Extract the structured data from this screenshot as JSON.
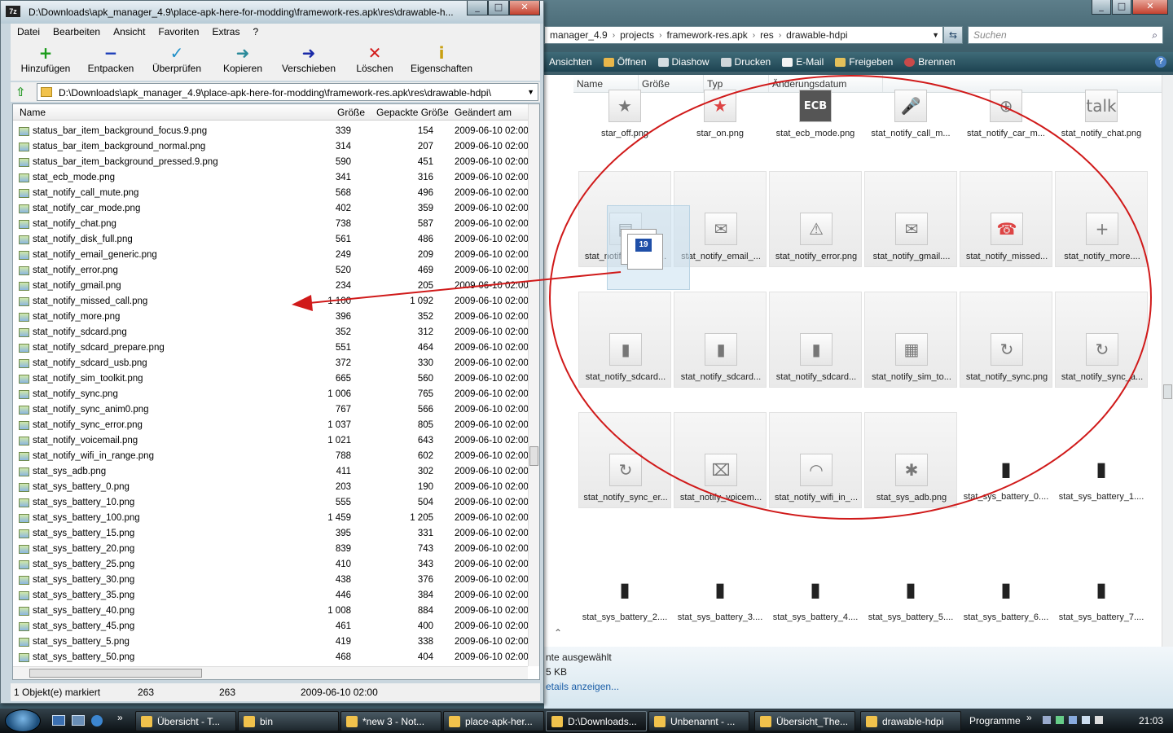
{
  "explorer": {
    "breadcrumb": [
      "manager_4.9",
      "projects",
      "framework-res.apk",
      "res",
      "drawable-hdpi"
    ],
    "search_placeholder": "Suchen",
    "commands": [
      "Ansichten",
      "Öffnen",
      "Diashow",
      "Drucken",
      "E-Mail",
      "Freigeben",
      "Brennen"
    ],
    "columns": [
      "Name",
      "Größe",
      "Typ",
      "Änderungsdatum"
    ],
    "tiles": [
      {
        "label": "star_off.png",
        "icon": "star-outline-icon",
        "glyph": "★"
      },
      {
        "label": "star_on.png",
        "icon": "star-filled-icon",
        "glyph": "★"
      },
      {
        "label": "stat_ecb_mode.png",
        "icon": "ecb-icon",
        "glyph": "ECB"
      },
      {
        "label": "stat_notify_call_m...",
        "icon": "mute-mic-icon",
        "glyph": "🎤"
      },
      {
        "label": "stat_notify_car_m...",
        "icon": "car-wheel-icon",
        "glyph": "⊕"
      },
      {
        "label": "stat_notify_chat.png",
        "icon": "talk-bubble-icon",
        "glyph": "talk"
      },
      {
        "label": "stat_notify_disk_fu...",
        "icon": "disk-icon",
        "glyph": "▤"
      },
      {
        "label": "stat_notify_email_...",
        "icon": "envelope-icon",
        "glyph": "✉"
      },
      {
        "label": "stat_notify_error.png",
        "icon": "warning-icon",
        "glyph": "⚠"
      },
      {
        "label": "stat_notify_gmail....",
        "icon": "gmail-envelope-icon",
        "glyph": "✉"
      },
      {
        "label": "stat_notify_missed...",
        "icon": "missed-call-icon",
        "glyph": "☎"
      },
      {
        "label": "stat_notify_more....",
        "icon": "plus-icon",
        "glyph": "+"
      },
      {
        "label": "stat_notify_sdcard...",
        "icon": "sdcard-icon",
        "glyph": "▮"
      },
      {
        "label": "stat_notify_sdcard...",
        "icon": "sdcard-prepare-icon",
        "glyph": "▮"
      },
      {
        "label": "stat_notify_sdcard...",
        "icon": "sdcard-usb-icon",
        "glyph": "▮"
      },
      {
        "label": "stat_notify_sim_to...",
        "icon": "sim-icon",
        "glyph": "▦"
      },
      {
        "label": "stat_notify_sync.png",
        "icon": "sync-icon",
        "glyph": "↻"
      },
      {
        "label": "stat_notify_sync_a...",
        "icon": "sync-anim-icon",
        "glyph": "↻"
      },
      {
        "label": "stat_notify_sync_er...",
        "icon": "sync-error-icon",
        "glyph": "↻"
      },
      {
        "label": "stat_notify_voicem...",
        "icon": "voicemail-icon",
        "glyph": "⌧"
      },
      {
        "label": "stat_notify_wifi_in_...",
        "icon": "wifi-icon",
        "glyph": "◠"
      },
      {
        "label": "stat_sys_adb.png",
        "icon": "android-icon",
        "glyph": "✱"
      },
      {
        "label": "stat_sys_battery_0....",
        "icon": "battery-icon",
        "glyph": "▮"
      },
      {
        "label": "stat_sys_battery_1....",
        "icon": "battery-icon",
        "glyph": "▮"
      },
      {
        "label": "stat_sys_battery_2....",
        "icon": "battery-icon",
        "glyph": "▮"
      },
      {
        "label": "stat_sys_battery_3....",
        "icon": "battery-icon",
        "glyph": "▮"
      },
      {
        "label": "stat_sys_battery_4....",
        "icon": "battery-icon",
        "glyph": "▮"
      },
      {
        "label": "stat_sys_battery_5....",
        "icon": "battery-icon",
        "glyph": "▮"
      },
      {
        "label": "stat_sys_battery_6....",
        "icon": "battery-icon",
        "glyph": "▮"
      },
      {
        "label": "stat_sys_battery_7....",
        "icon": "battery-icon",
        "glyph": "▮"
      }
    ],
    "drag_badge": "19",
    "details_line1": "nte ausgewählt",
    "details_line2": "5 KB",
    "details_link": "etails anzeigen..."
  },
  "sevenzip": {
    "title": "D:\\Downloads\\apk_manager_4.9\\place-apk-here-for-modding\\framework-res.apk\\res\\drawable-h...",
    "app_icon": "7z",
    "menu": [
      "Datei",
      "Bearbeiten",
      "Ansicht",
      "Favoriten",
      "Extras",
      "?"
    ],
    "toolbar": [
      {
        "label": "Hinzufügen",
        "glyph": "+",
        "color": "#1a9b1a"
      },
      {
        "label": "Entpacken",
        "glyph": "−",
        "color": "#1a3cb8"
      },
      {
        "label": "Überprüfen",
        "glyph": "✓",
        "color": "#1f8fc8"
      },
      {
        "label": "Kopieren",
        "glyph": "➜",
        "color": "#2a8a9a"
      },
      {
        "label": "Verschieben",
        "glyph": "➜",
        "color": "#1a2aa8"
      },
      {
        "label": "Löschen",
        "glyph": "✕",
        "color": "#d21818"
      },
      {
        "label": "Eigenschaften",
        "glyph": "i",
        "color": "#c9a012"
      }
    ],
    "path": "D:\\Downloads\\apk_manager_4.9\\place-apk-here-for-modding\\framework-res.apk\\res\\drawable-hdpi\\",
    "columns": {
      "name": "Name",
      "size": "Größe",
      "packed": "Gepackte Größe",
      "modified": "Geändert am"
    },
    "files": [
      {
        "name": "status_bar_item_background_focus.9.png",
        "size": "339",
        "packed": "154",
        "date": "2009-06-10 02:00"
      },
      {
        "name": "status_bar_item_background_normal.png",
        "size": "314",
        "packed": "207",
        "date": "2009-06-10 02:00"
      },
      {
        "name": "status_bar_item_background_pressed.9.png",
        "size": "590",
        "packed": "451",
        "date": "2009-06-10 02:00"
      },
      {
        "name": "stat_ecb_mode.png",
        "size": "341",
        "packed": "316",
        "date": "2009-06-10 02:00"
      },
      {
        "name": "stat_notify_call_mute.png",
        "size": "568",
        "packed": "496",
        "date": "2009-06-10 02:00"
      },
      {
        "name": "stat_notify_car_mode.png",
        "size": "402",
        "packed": "359",
        "date": "2009-06-10 02:00"
      },
      {
        "name": "stat_notify_chat.png",
        "size": "738",
        "packed": "587",
        "date": "2009-06-10 02:00"
      },
      {
        "name": "stat_notify_disk_full.png",
        "size": "561",
        "packed": "486",
        "date": "2009-06-10 02:00"
      },
      {
        "name": "stat_notify_email_generic.png",
        "size": "249",
        "packed": "209",
        "date": "2009-06-10 02:00"
      },
      {
        "name": "stat_notify_error.png",
        "size": "520",
        "packed": "469",
        "date": "2009-06-10 02:00"
      },
      {
        "name": "stat_notify_gmail.png",
        "size": "234",
        "packed": "205",
        "date": "2009-06-10 02:00"
      },
      {
        "name": "stat_notify_missed_call.png",
        "size": "1 100",
        "packed": "1 092",
        "date": "2009-06-10 02:00"
      },
      {
        "name": "stat_notify_more.png",
        "size": "396",
        "packed": "352",
        "date": "2009-06-10 02:00"
      },
      {
        "name": "stat_notify_sdcard.png",
        "size": "352",
        "packed": "312",
        "date": "2009-06-10 02:00"
      },
      {
        "name": "stat_notify_sdcard_prepare.png",
        "size": "551",
        "packed": "464",
        "date": "2009-06-10 02:00"
      },
      {
        "name": "stat_notify_sdcard_usb.png",
        "size": "372",
        "packed": "330",
        "date": "2009-06-10 02:00"
      },
      {
        "name": "stat_notify_sim_toolkit.png",
        "size": "665",
        "packed": "560",
        "date": "2009-06-10 02:00"
      },
      {
        "name": "stat_notify_sync.png",
        "size": "1 006",
        "packed": "765",
        "date": "2009-06-10 02:00"
      },
      {
        "name": "stat_notify_sync_anim0.png",
        "size": "767",
        "packed": "566",
        "date": "2009-06-10 02:00"
      },
      {
        "name": "stat_notify_sync_error.png",
        "size": "1 037",
        "packed": "805",
        "date": "2009-06-10 02:00"
      },
      {
        "name": "stat_notify_voicemail.png",
        "size": "1 021",
        "packed": "643",
        "date": "2009-06-10 02:00"
      },
      {
        "name": "stat_notify_wifi_in_range.png",
        "size": "788",
        "packed": "602",
        "date": "2009-06-10 02:00"
      },
      {
        "name": "stat_sys_adb.png",
        "size": "411",
        "packed": "302",
        "date": "2009-06-10 02:00"
      },
      {
        "name": "stat_sys_battery_0.png",
        "size": "203",
        "packed": "190",
        "date": "2009-06-10 02:00"
      },
      {
        "name": "stat_sys_battery_10.png",
        "size": "555",
        "packed": "504",
        "date": "2009-06-10 02:00"
      },
      {
        "name": "stat_sys_battery_100.png",
        "size": "1 459",
        "packed": "1 205",
        "date": "2009-06-10 02:00"
      },
      {
        "name": "stat_sys_battery_15.png",
        "size": "395",
        "packed": "331",
        "date": "2009-06-10 02:00"
      },
      {
        "name": "stat_sys_battery_20.png",
        "size": "839",
        "packed": "743",
        "date": "2009-06-10 02:00"
      },
      {
        "name": "stat_sys_battery_25.png",
        "size": "410",
        "packed": "343",
        "date": "2009-06-10 02:00"
      },
      {
        "name": "stat_sys_battery_30.png",
        "size": "438",
        "packed": "376",
        "date": "2009-06-10 02:00"
      },
      {
        "name": "stat_sys_battery_35.png",
        "size": "446",
        "packed": "384",
        "date": "2009-06-10 02:00"
      },
      {
        "name": "stat_sys_battery_40.png",
        "size": "1 008",
        "packed": "884",
        "date": "2009-06-10 02:00"
      },
      {
        "name": "stat_sys_battery_45.png",
        "size": "461",
        "packed": "400",
        "date": "2009-06-10 02:00"
      },
      {
        "name": "stat_sys_battery_5.png",
        "size": "419",
        "packed": "338",
        "date": "2009-06-10 02:00"
      },
      {
        "name": "stat_sys_battery_50.png",
        "size": "468",
        "packed": "404",
        "date": "2009-06-10 02:00"
      }
    ],
    "status": {
      "selected": "1 Objekt(e) markiert",
      "size": "263",
      "packed": "263",
      "date": "2009-06-10 02:00"
    }
  },
  "taskbar": {
    "items": [
      {
        "label": "Übersicht - T...",
        "active": false
      },
      {
        "label": "bin",
        "active": false
      },
      {
        "label": "*new 3 - Not...",
        "active": false
      },
      {
        "label": "place-apk-her...",
        "active": false
      },
      {
        "label": "D:\\Downloads...",
        "active": true
      },
      {
        "label": "Unbenannt - ...",
        "active": false
      },
      {
        "label": "Übersicht_The...",
        "active": false
      },
      {
        "label": "drawable-hdpi",
        "active": false
      }
    ],
    "programs": "Programme",
    "clock": "21:03"
  },
  "colors": {
    "annotation_red": "#d01a1a",
    "accent": "#1e4452"
  }
}
